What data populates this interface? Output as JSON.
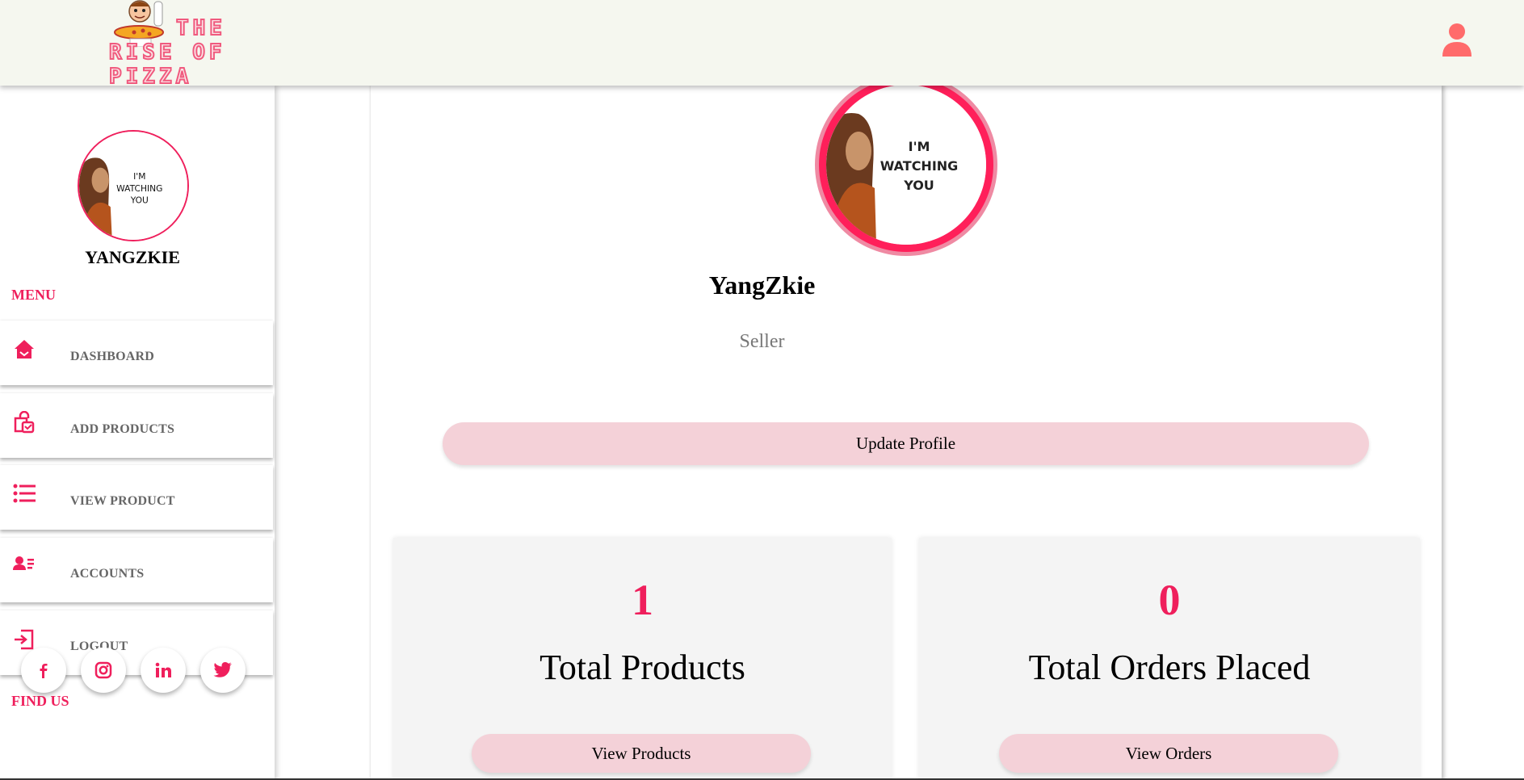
{
  "header": {
    "logo_line1": "THE",
    "logo_line2": "RISE OF PIZZA",
    "user_icon": "user-icon"
  },
  "avatar_text": {
    "line1": "I'M",
    "line2": "WATCHING",
    "line3": "YOU"
  },
  "sidebar": {
    "username": "YANGZKIE",
    "menu_title": "MENU",
    "items": [
      {
        "label": "DASHBOARD",
        "icon": "home-icon"
      },
      {
        "label": "ADD PRODUCTS",
        "icon": "shopping-bag-icon"
      },
      {
        "label": "VIEW PRODUCT",
        "icon": "list-icon"
      },
      {
        "label": "ACCOUNTS",
        "icon": "user-list-icon"
      },
      {
        "label": "LOGOUT",
        "icon": "logout-icon"
      }
    ],
    "find_us_title": "FIND US",
    "socials": [
      "facebook-icon",
      "instagram-icon",
      "linkedin-icon",
      "twitter-icon"
    ]
  },
  "profile": {
    "name": "YangZkie",
    "role": "Seller",
    "update_label": "Update Profile"
  },
  "stats": [
    {
      "value": "1",
      "label": "Total Products",
      "button": "View Products"
    },
    {
      "value": "0",
      "label": "Total Orders Placed",
      "button": "View Orders"
    }
  ],
  "colors": {
    "accent": "#ef1f5c",
    "header_bg": "#f5f7ef",
    "button_bg": "#f4d1d8",
    "card_bg": "#f4f4f4"
  }
}
